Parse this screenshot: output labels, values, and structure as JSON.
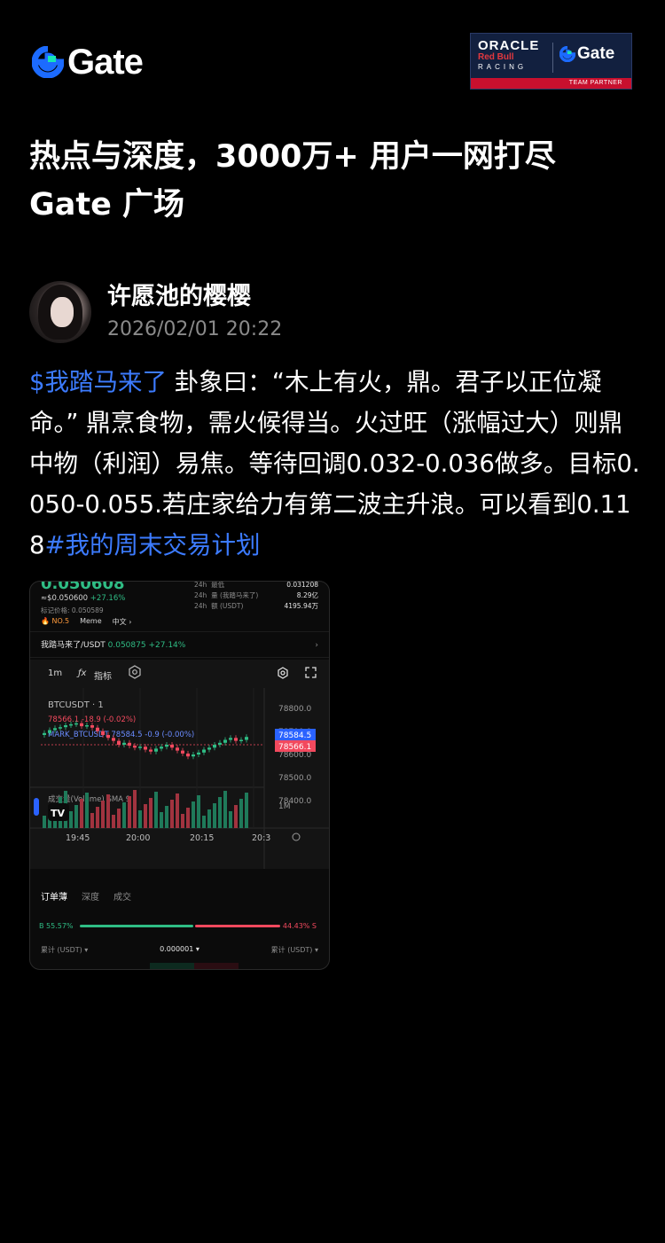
{
  "brand": {
    "logo_text": "Gate",
    "logo_icon": "gate-logo-icon",
    "accent": "#1c6bff"
  },
  "partner_badge": {
    "oracle": "ORACLE",
    "redbull": "Red Bull",
    "racing": "RACING",
    "gate": "Gate",
    "caption": "TEAM PARTNER"
  },
  "headline": {
    "line1": "热点与深度，3000万+ 用户一网打尽",
    "line2": "Gate 广场"
  },
  "author": {
    "name": "许愿池的樱樱",
    "timestamp": "2026/02/01 20:22"
  },
  "post": {
    "tag_start": "$我踏马来了",
    "text": " 卦象曰：“木上有火，鼎。君子以正位凝命。” 鼎烹食物，需火候得当。火过旺（涨幅过大）则鼎中物（利润）易焦。等待回调0.032-0.036做多。目标0.050-0.055.若庄家给力有第二波主升浪。可以看到0.118",
    "tag_end": "#我的周末交易计划"
  },
  "screenshot": {
    "price_big": "0.050608",
    "price_usd": "≈$0.050600",
    "price_change": "+27.16%",
    "mark_price": "标记价格: 0.050589",
    "badge_rank": "NO.5",
    "badge_meme": "Meme",
    "badge_lang": "中文",
    "stats": [
      {
        "label": "24h",
        "name": "最低",
        "value": "0.031208"
      },
      {
        "label": "24h",
        "name": "量 (我踏马来了)",
        "value": "8.29亿"
      },
      {
        "label": "24h",
        "name": "额 (USDT)",
        "value": "4195.94万"
      }
    ],
    "pair": "我踏马来了/USDT",
    "pair_price": "0.050875",
    "pair_change": "+27.14%",
    "toolbar": {
      "interval": "1m",
      "indicators": "指标"
    },
    "chart_labels": {
      "symbol": "BTCUSDT · 1",
      "last_line": "78566.1  -18.9 (-0.02%)",
      "mark_line": "MARK_BTCUSDT  78584.5  -0.9 (-0.00%)",
      "volume": "成交量(Volume) SMA 9",
      "vol_tick": "1M",
      "tv": "TV"
    },
    "y_ticks": [
      "78800.0",
      "78700.0",
      "78600.0",
      "78500.0",
      "78400.0"
    ],
    "price_tags": {
      "blue": "78584.5",
      "red": "78566.1"
    },
    "x_ticks": [
      "19:45",
      "20:00",
      "20:15",
      "20:3"
    ],
    "tabs": [
      "订单薄",
      "深度",
      "成交"
    ],
    "ratio": {
      "buy_label": "B 55.57%",
      "sell_label": "44.43% S",
      "buy": 55.57,
      "sell": 44.43
    },
    "foot": {
      "left": "累计 (USDT)",
      "mid": "0.000001",
      "right": "累计 (USDT)"
    }
  }
}
